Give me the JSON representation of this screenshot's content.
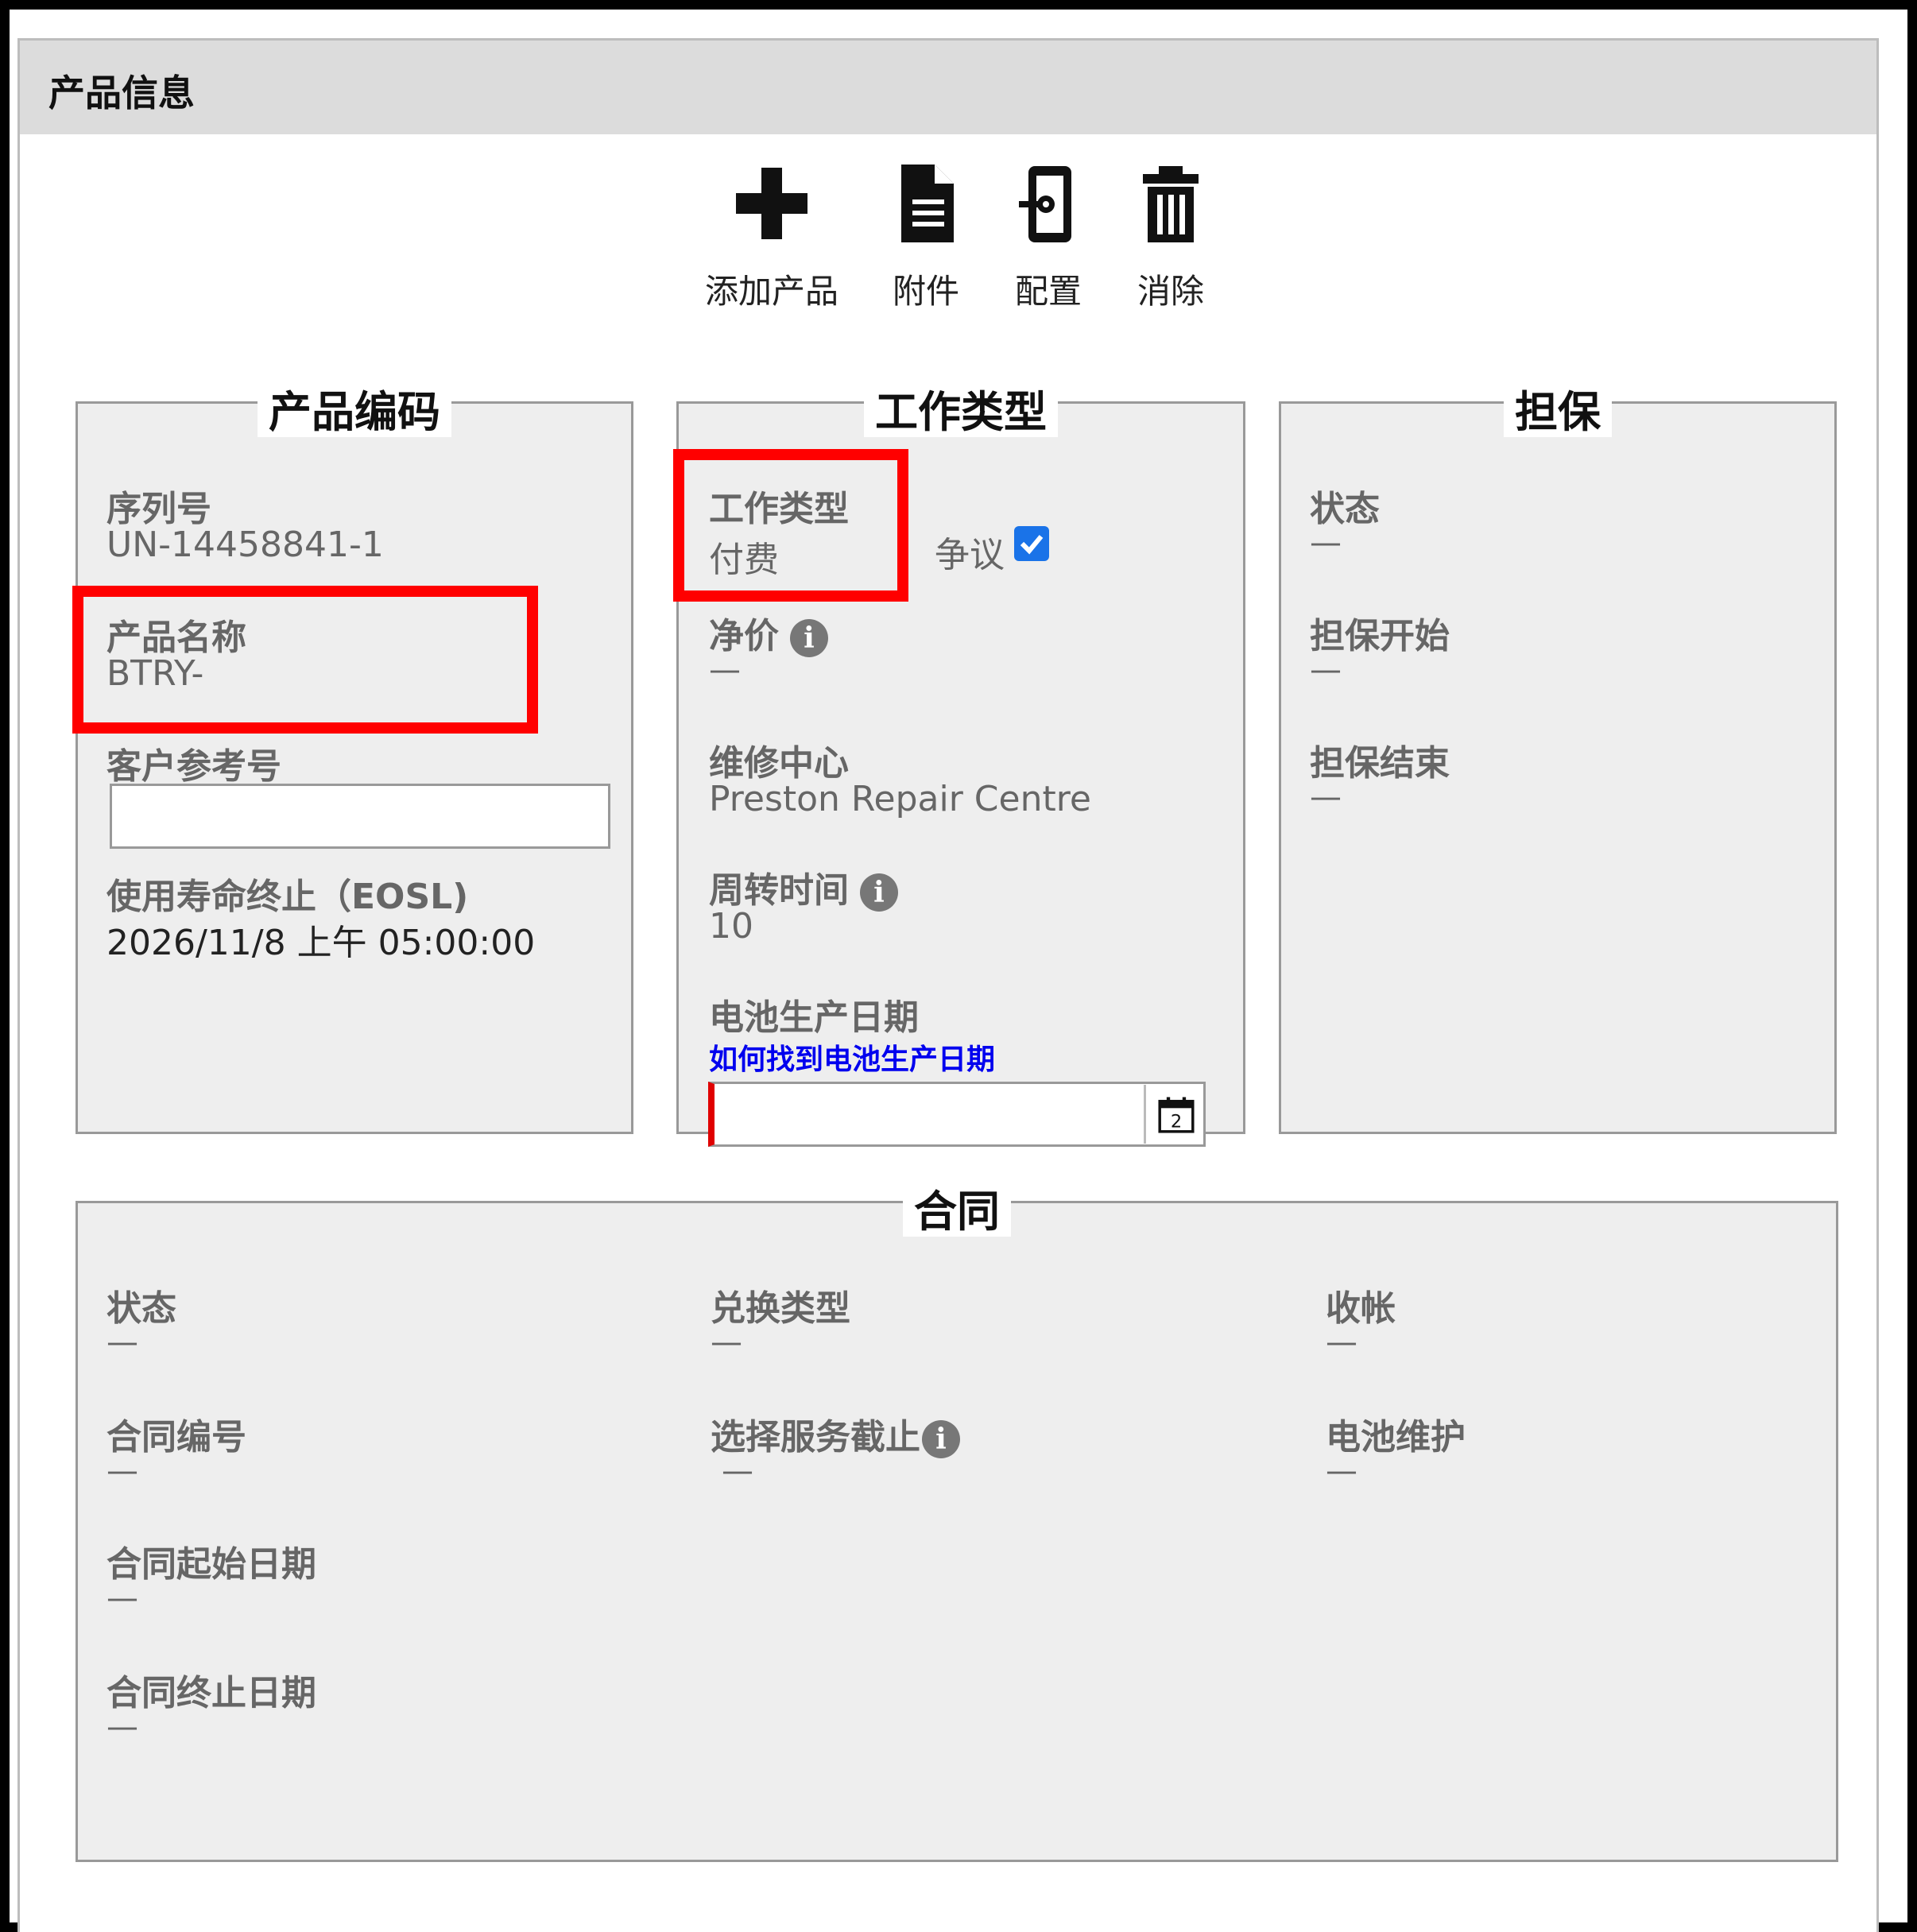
{
  "panel": {
    "title": "产品信息"
  },
  "toolbar": {
    "add_label": "添加产品",
    "attachment_label": "附件",
    "config_label": "配置",
    "delete_label": "消除"
  },
  "product_code": {
    "heading": "产品编码",
    "serial_label": "序列号",
    "serial_value": "UN-14458841-1",
    "name_label": "产品名称",
    "name_value": "BTRY-",
    "customer_ref_label": "客户参考号",
    "customer_ref_value": "",
    "eosl_label": "使用寿命终止（EOSL)",
    "eosl_value": "2026/11/8 上午 05:00:00"
  },
  "work_type": {
    "heading": "工作类型",
    "type_label": "工作类型",
    "type_value": "付费",
    "dispute_label": "争议",
    "dispute_checked": true,
    "net_price_label": "净价",
    "net_price_value": "—",
    "repair_center_label": "维修中心",
    "repair_center_value": "Preston Repair Centre",
    "turnaround_label": "周转时间",
    "turnaround_value": "10",
    "battery_date_label": "电池生产日期",
    "battery_date_link": "如何找到电池生产日期",
    "battery_date_value": "",
    "calendar_day": "2"
  },
  "warranty": {
    "heading": "担保",
    "status_label": "状态",
    "status_value": "—",
    "start_label": "担保开始",
    "start_value": "—",
    "end_label": "担保结束",
    "end_value": "—"
  },
  "contract": {
    "heading": "合同",
    "status_label": "状态",
    "status_value": "—",
    "number_label": "合同编号",
    "number_value": "—",
    "start_label": "合同起始日期",
    "start_value": "—",
    "end_label": "合同终止日期",
    "end_value": "—",
    "exchange_label": "兑换类型",
    "exchange_value": "—",
    "service_cutoff_label": "选择服务截止",
    "service_cutoff_value": "—",
    "billing_label": "收帐",
    "billing_value": "—",
    "battery_maint_label": "电池维护",
    "battery_maint_value": "—"
  }
}
